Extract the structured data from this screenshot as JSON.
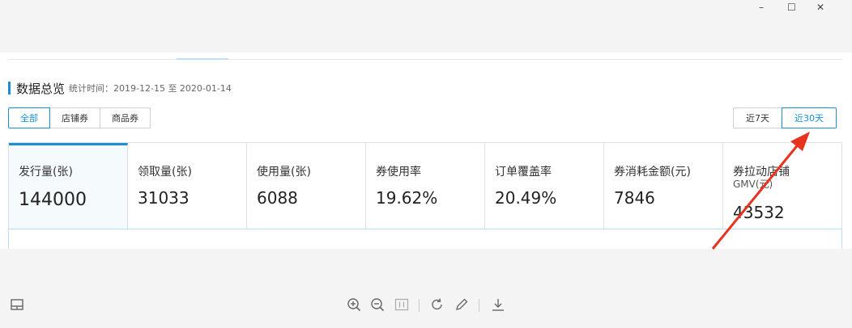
{
  "window": {
    "minimize_icon": "–",
    "maximize_icon": "☐",
    "close_icon": "✕"
  },
  "overview": {
    "title": "数据总览",
    "stat_label": "统计时间：",
    "stat_range": "2019-12-15 至 2020-01-14"
  },
  "type_tabs": [
    "全部",
    "店铺券",
    "商品券"
  ],
  "range_tabs": [
    "近7天",
    "近30天"
  ],
  "metrics": [
    {
      "label": "发行量(张)",
      "value": "144000"
    },
    {
      "label": "领取量(张)",
      "value": "31033"
    },
    {
      "label": "使用量(张)",
      "value": "6088"
    },
    {
      "label": "券使用率",
      "value": "19.62%"
    },
    {
      "label": "订单覆盖率",
      "value": "20.49%"
    },
    {
      "label": "券消耗金额(元)",
      "value": "7846"
    },
    {
      "label": "券拉动店铺",
      "sub": "GMV(元)",
      "value": "43532"
    }
  ],
  "colors": {
    "accent": "#1a8fd8",
    "annotation_arrow": "#e8321e"
  },
  "toolbar_icons": [
    "layout-icon",
    "zoom-in-icon",
    "zoom-out-icon",
    "actual-size-icon",
    "rotate-icon",
    "edit-icon",
    "download-icon"
  ]
}
